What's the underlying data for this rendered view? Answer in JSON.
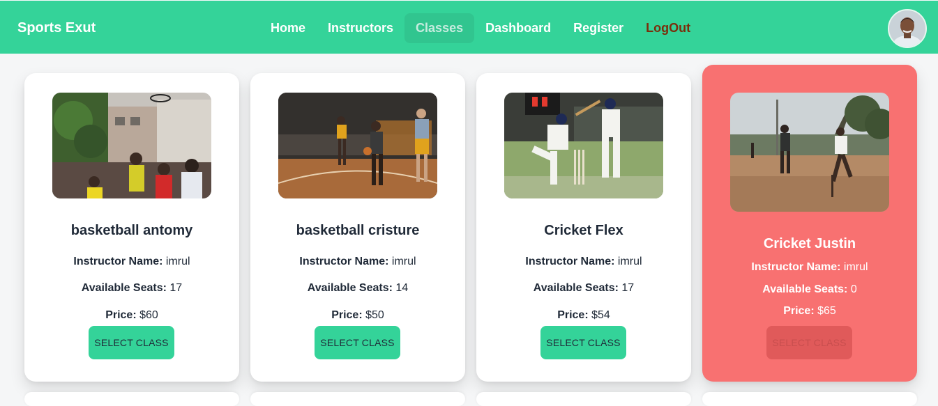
{
  "nav": {
    "brand": "Sports Exut",
    "links": [
      "Home",
      "Instructors",
      "Classes",
      "Dashboard",
      "Register",
      "LogOut"
    ],
    "active": "Classes"
  },
  "labels": {
    "instructor": "Instructor Name:",
    "seats": "Available Seats:",
    "price": "Price:"
  },
  "classes": [
    {
      "name": "basketball antomy",
      "instructor": "imrul",
      "seats": "17",
      "price": "$60",
      "button": "SELECT CLASS"
    },
    {
      "name": "basketball cristure",
      "instructor": "imrul",
      "seats": "14",
      "price": "$50",
      "button": "SELECT CLASS"
    },
    {
      "name": "Cricket Flex",
      "instructor": "imrul",
      "seats": "17",
      "price": "$54",
      "button": "SELECT CLASS"
    },
    {
      "name": "Cricket Justin",
      "instructor": "imrul",
      "seats": "0",
      "price": "$65",
      "button": "SELECT CLASS"
    }
  ],
  "colors": {
    "primary": "#34d399",
    "full_card": "#f87171",
    "logout": "#7a2e0b"
  }
}
